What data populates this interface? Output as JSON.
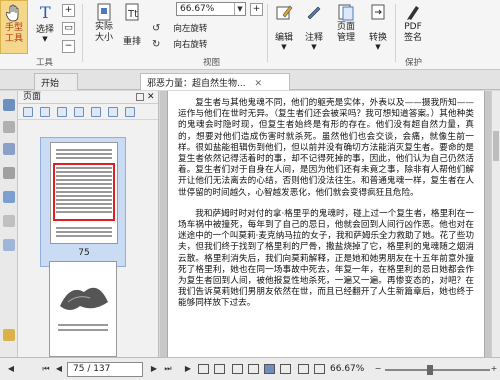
{
  "ribbon": {
    "hand_tool": "手型\n工具",
    "select": "选择",
    "actual_size": "实际\n大小",
    "reflow": "重排",
    "zoom_value": "66.67%",
    "rotate_left": "向左旋转",
    "rotate_right": "向右旋转",
    "edit": "编辑",
    "comment": "注释",
    "page_manage": "页面\n管理",
    "convert": "转换",
    "pdf_sign": "PDF\n签名",
    "group_tools": "工具",
    "group_view": "视图",
    "group_protect": "保护"
  },
  "tabs": [
    {
      "label": "开始"
    },
    {
      "label": "邪恶力量：超自然生物..."
    }
  ],
  "panel": {
    "title": "页面",
    "thumb_page_number": "75"
  },
  "document": {
    "paragraphs": [
      "复生者与其他鬼魂不同，他们的躯壳是实体，外表以及——摄我所知——运作与他们在世时无异。（复生者们还会被采吗？我可想知道答案。）其他种类的鬼魂会时隐时现，但复生者始终是有形的存在。他们没有超自然力量，真的，想要对他们造成伤害时就杀死。虽然他们也会交谈，会痛，就像生前一样。很如盐能祖辑伤到他们，但以前并没有确切方法能消灭复生者。要命的是复生者依然记得活着时的事，却不记得死掉的事，因此，他们认为自己仍然活着。复生者们对于自身在人间，是因为他们还有未竟之事，除非有人帮他们解开让他们无法离去的心结，否则他们没法往生。和普通鬼魂一样，复生者在人世停留的时间越久，心智越发恶化，他们就会变得疯狂且危险。",
      "我和萨姆时时对付的拿·格里乎的鬼魂时，碰上过一个复生者，格里利在一场车祸中被撞死，每年到了自己的忌日，他就会回到人间行凶作恶。他也对在迷途中的一个叫莫莉·麦克纳马拉的女子，我和萨姆乐全力救助了她。花了些功夫，但我们终于找到了格里利的尸骨，撒盐烧掉了它，格里利的鬼魂随之烟消云散。格里利消失后，我们向莫莉解释，正是她和她男朋友在十五年前意外撞死了格里利，她也在同一场事故中死去，年复一年，在格里利的忌日她都会作为复生者回到人间，被他报复性地杀死，一遍又一遍。再惨变态的，对吧？在我们告诉莫莉她们男朋友依然在世，而且已经翻开了人生新篇章后，她也终于能够同样放下过去。"
    ]
  },
  "status": {
    "page_indicator": "75 / 137",
    "zoom": "66.67%"
  }
}
